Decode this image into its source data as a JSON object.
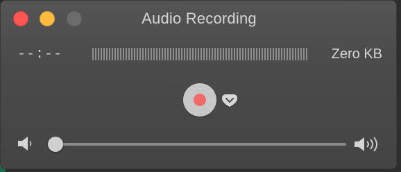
{
  "window": {
    "title": "Audio Recording",
    "traffic_lights": [
      "close",
      "minimize",
      "zoom"
    ]
  },
  "recorder": {
    "elapsed_time": "--:--",
    "file_size": "Zero KB",
    "record_button": {
      "icon": "record-icon",
      "color": "#f26b6b"
    },
    "options_button": {
      "icon": "chevron-down-icon"
    }
  },
  "volume": {
    "level_fraction": 0.0,
    "low_icon": "speaker-low-icon",
    "high_icon": "speaker-high-icon"
  },
  "colors": {
    "window_bg": "#4b4b4b",
    "close": "#fc5753",
    "minimize": "#fdbc40",
    "zoom": "#6c6c6c"
  }
}
